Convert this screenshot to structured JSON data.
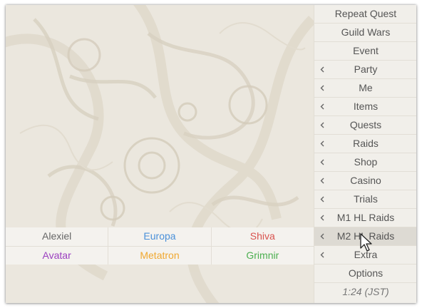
{
  "menu": {
    "items": [
      {
        "label": "Repeat Quest",
        "has_submenu": false
      },
      {
        "label": "Guild Wars",
        "has_submenu": false
      },
      {
        "label": "Event",
        "has_submenu": false
      },
      {
        "label": "Party",
        "has_submenu": true
      },
      {
        "label": "Me",
        "has_submenu": true
      },
      {
        "label": "Items",
        "has_submenu": true
      },
      {
        "label": "Quests",
        "has_submenu": true
      },
      {
        "label": "Raids",
        "has_submenu": true
      },
      {
        "label": "Shop",
        "has_submenu": true
      },
      {
        "label": "Casino",
        "has_submenu": true
      },
      {
        "label": "Trials",
        "has_submenu": true
      },
      {
        "label": "M1 HL Raids",
        "has_submenu": true
      },
      {
        "label": "M2 HL Raids",
        "has_submenu": true,
        "hovered": true
      },
      {
        "label": "Extra",
        "has_submenu": true
      },
      {
        "label": "Options",
        "has_submenu": false
      }
    ],
    "clock": "1:24 (JST)",
    "chevron_icon": "chevron-left-icon"
  },
  "submenu": {
    "rows": [
      [
        {
          "label": "Alexiel",
          "color": "#666666"
        },
        {
          "label": "Europa",
          "color": "#4a90d9"
        },
        {
          "label": "Shiva",
          "color": "#d9534f"
        }
      ],
      [
        {
          "label": "Avatar",
          "color": "#9b3fc0"
        },
        {
          "label": "Metatron",
          "color": "#f0a830"
        },
        {
          "label": "Grimnir",
          "color": "#4caf50"
        }
      ]
    ]
  }
}
